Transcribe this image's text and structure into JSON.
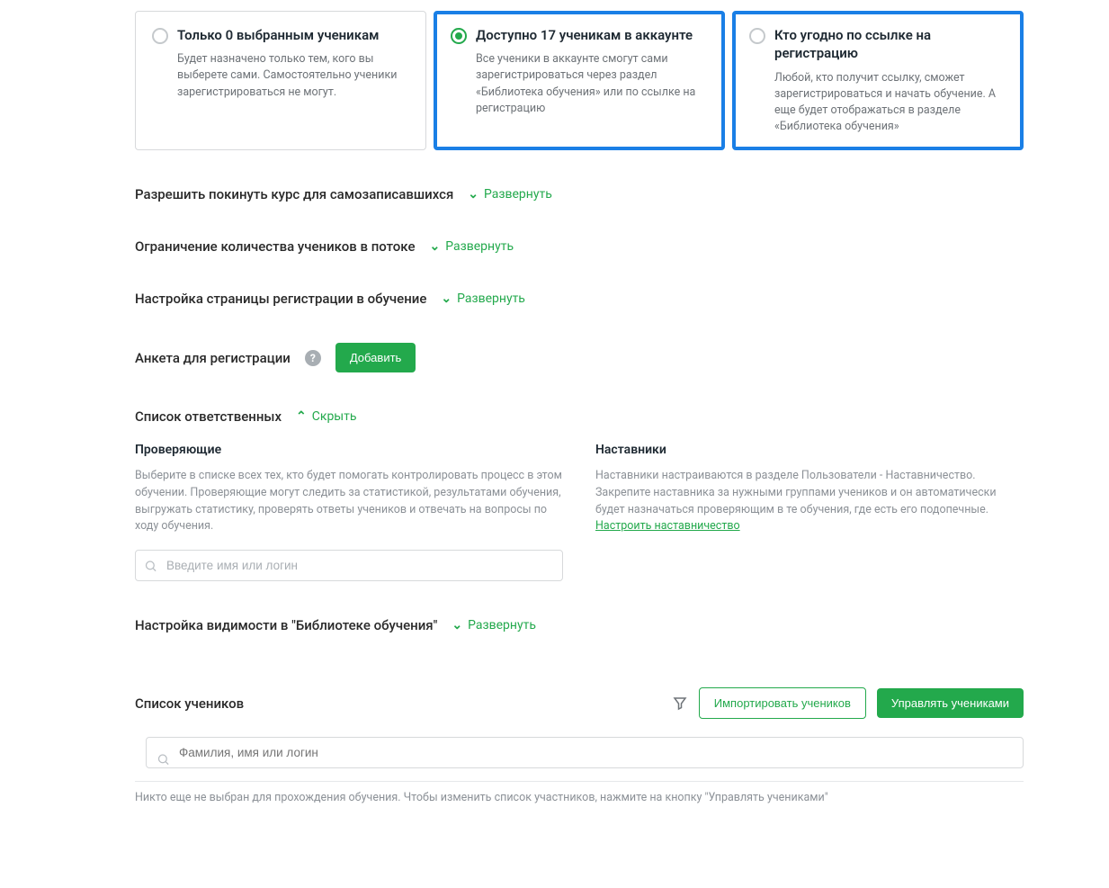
{
  "access": {
    "option1": {
      "title": "Только 0 выбранным ученикам",
      "desc": "Будет назначено только тем, кого вы выберете сами. Самостоятельно ученики зарегистрироваться не могут."
    },
    "option2": {
      "title": "Доступно 17 ученикам в аккаунте",
      "desc": "Все ученики в аккаунте смогут сами зарегистрироваться через раздел «Библиотека обучения» или по ссылке на регистрацию"
    },
    "option3": {
      "title": "Кто угодно по ссылке на регистрацию",
      "desc": "Любой, кто получит ссылку, сможет зарегистрироваться и начать обучение. А еще будет отображаться в разделе «Библиотека обучения»"
    }
  },
  "settings": {
    "leaveCourse": {
      "title": "Разрешить покинуть курс для самозаписавшихся",
      "toggle": "Развернуть"
    },
    "limitStudents": {
      "title": "Ограничение количества учеников в потоке",
      "toggle": "Развернуть"
    },
    "regPage": {
      "title": "Настройка страницы регистрации в обучение",
      "toggle": "Развернуть"
    },
    "regForm": {
      "title": "Анкета для регистрации",
      "button": "Добавить"
    },
    "responsible": {
      "title": "Список ответственных",
      "toggle": "Скрыть",
      "reviewers": {
        "heading": "Проверяющие",
        "help": "Выберите в списке всех тех, кто будет помогать контролировать процесс в этом обучении. Проверяющие могут следить за статистикой, результатами обучения, выгружать статистику, проверять ответы учеников и отвечать на вопросы по ходу обучения.",
        "placeholder": "Введите имя или логин"
      },
      "mentors": {
        "heading": "Наставники",
        "help": "Наставники настраиваются в разделе Пользователи - Наставничество. Закрепите наставника за нужными группами учеников и он автоматически будет назначаться проверяющим в те обучения, где есть его подопечные. ",
        "link": "Настроить наставничество"
      }
    },
    "visibility": {
      "title": "Настройка видимости в \"Библиотеке обучения\"",
      "toggle": "Развернуть"
    }
  },
  "students": {
    "title": "Список учеников",
    "importBtn": "Импортировать учеников",
    "manageBtn": "Управлять учениками",
    "searchPlaceholder": "Фамилия, имя или логин",
    "emptyMsg": "Никто еще не выбран для прохождения обучения. Чтобы изменить список участников, нажмите на кнопку \"Управлять учениками\""
  }
}
